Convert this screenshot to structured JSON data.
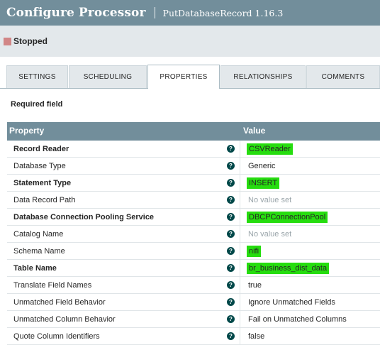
{
  "header": {
    "title": "Configure Processor",
    "subtitle": "PutDatabaseRecord 1.16.3"
  },
  "status": {
    "text": "Stopped",
    "color": "#d18686"
  },
  "tabs": [
    {
      "label": "SETTINGS",
      "active": false
    },
    {
      "label": "SCHEDULING",
      "active": false
    },
    {
      "label": "PROPERTIES",
      "active": true
    },
    {
      "label": "RELATIONSHIPS",
      "active": false
    },
    {
      "label": "COMMENTS",
      "active": false
    }
  ],
  "required_label": "Required field",
  "table": {
    "headers": {
      "property": "Property",
      "value": "Value"
    },
    "rows": [
      {
        "name": "Record Reader",
        "value": "CSVReader",
        "required": true,
        "highlighted": true
      },
      {
        "name": "Database Type",
        "value": "Generic",
        "required": false,
        "highlighted": false
      },
      {
        "name": "Statement Type",
        "value": "INSERT",
        "required": true,
        "highlighted": true
      },
      {
        "name": "Data Record Path",
        "value": "No value set",
        "required": false,
        "highlighted": false,
        "empty": true
      },
      {
        "name": "Database Connection Pooling Service",
        "value": "DBCPConnectionPool",
        "required": true,
        "highlighted": true
      },
      {
        "name": "Catalog Name",
        "value": "No value set",
        "required": false,
        "highlighted": false,
        "empty": true
      },
      {
        "name": "Schema Name",
        "value": "nifi",
        "required": false,
        "highlighted": true
      },
      {
        "name": "Table Name",
        "value": "br_business_dist_data",
        "required": true,
        "highlighted": true
      },
      {
        "name": "Translate Field Names",
        "value": "true",
        "required": false,
        "highlighted": false
      },
      {
        "name": "Unmatched Field Behavior",
        "value": "Ignore Unmatched Fields",
        "required": false,
        "highlighted": false
      },
      {
        "name": "Unmatched Column Behavior",
        "value": "Fail on Unmatched Columns",
        "required": false,
        "highlighted": false
      },
      {
        "name": "Quote Column Identifiers",
        "value": "false",
        "required": false,
        "highlighted": false
      }
    ]
  },
  "colors": {
    "header_bg": "#728e9b",
    "highlight": "#26dd0f",
    "help_icon": "#004849"
  },
  "icons": {
    "help": "question-circle-icon"
  }
}
